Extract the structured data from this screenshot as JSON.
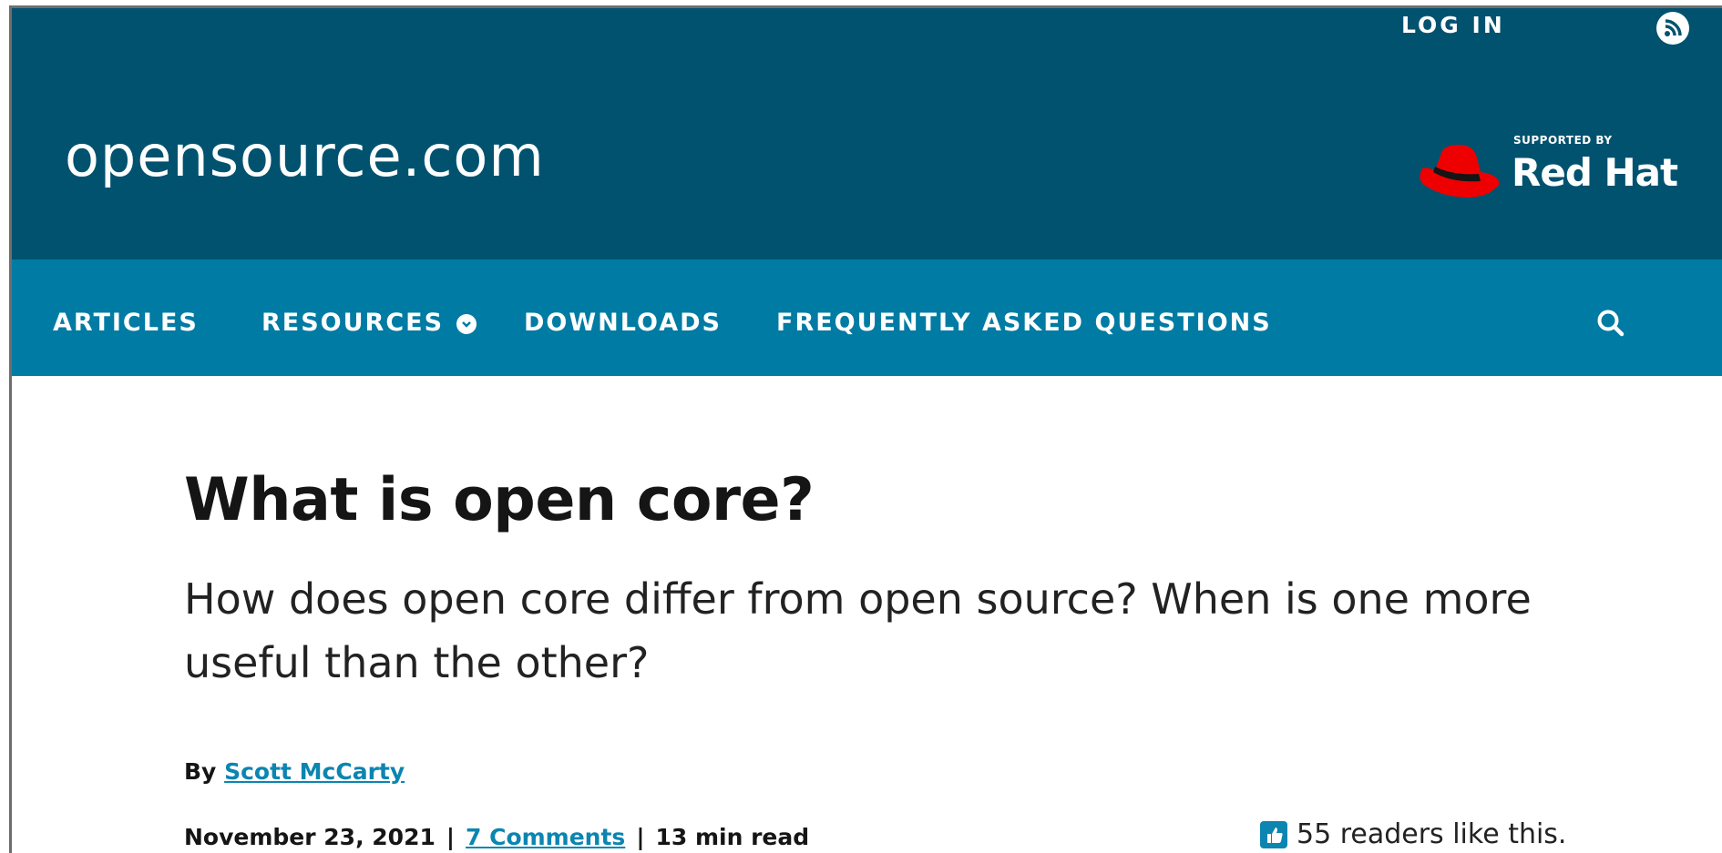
{
  "header": {
    "login_label": "LOG IN",
    "rss_icon": "rss-icon",
    "site_name": "opensource.com",
    "sponsor_supported": "SUPPORTED BY",
    "sponsor_name": "Red Hat",
    "colors": {
      "topbar": "#00526f",
      "navbar": "#007ba3",
      "redhat": "#ee0000"
    }
  },
  "nav": {
    "items": [
      {
        "label": "ARTICLES"
      },
      {
        "label": "RESOURCES"
      },
      {
        "label": "DOWNLOADS"
      },
      {
        "label": "FREQUENTLY ASKED QUESTIONS"
      }
    ],
    "search_icon": "search-icon"
  },
  "article": {
    "title": "What is open core?",
    "subtitle": "How does open core differ from open source? When is one more useful than the other?",
    "by_label": "By",
    "author": "Scott McCarty",
    "date": "November 23, 2021",
    "separator": "|",
    "comments": "7 Comments",
    "read_time": "13 min read",
    "likes": "55 readers like this.",
    "link_color": "#0c85b0"
  }
}
